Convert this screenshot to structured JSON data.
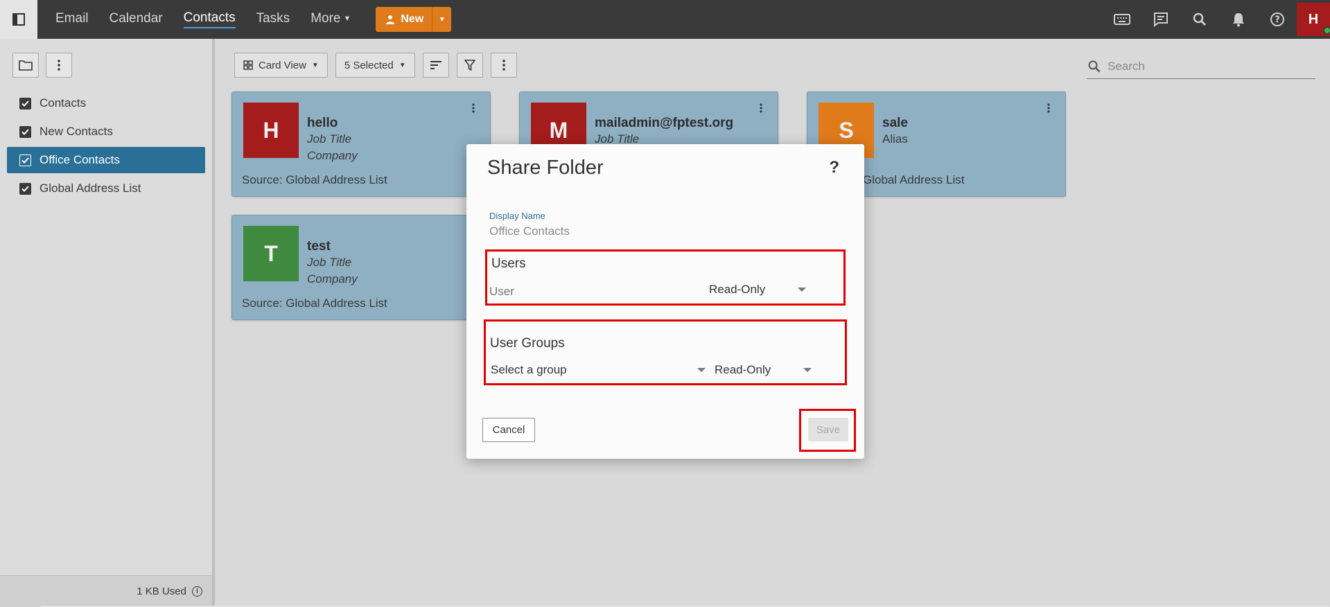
{
  "nav": {
    "links": [
      "Email",
      "Calendar",
      "Contacts",
      "Tasks",
      "More"
    ],
    "new_label": "New"
  },
  "user": {
    "initial": "H",
    "status_color": "#3cb44b",
    "avatar_color": "#a51c1c"
  },
  "sidebar": {
    "folders": [
      {
        "label": "Contacts",
        "checked": true
      },
      {
        "label": "New Contacts",
        "checked": true
      },
      {
        "label": "Office Contacts",
        "checked": true,
        "selected": true
      },
      {
        "label": "Global Address List",
        "checked": true
      }
    ],
    "quota": "1 KB Used"
  },
  "toolbar": {
    "view_label": "Card View",
    "selected_label": "5 Selected",
    "search_placeholder": "Search"
  },
  "cards": [
    {
      "initial": "H",
      "color": "#a51c1c",
      "name": "hello",
      "line1": "Job Title",
      "line2": "Company",
      "source": "Source: Global Address List"
    },
    {
      "initial": "M",
      "color": "#a51c1c",
      "name": "mailadmin@fptest.org",
      "line1": "Job Title",
      "line2": "",
      "source": ""
    },
    {
      "initial": "S",
      "color": "#e07b1c",
      "name": "sale",
      "line1": "Alias",
      "line2": "",
      "source": "Global Address List"
    },
    {
      "initial": "T",
      "color": "#3f8a3f",
      "name": "test",
      "line1": "Job Title",
      "line2": "Company",
      "source": "Source: Global Address List"
    }
  ],
  "dialog": {
    "title": "Share Folder",
    "help": "?",
    "display_name_label": "Display Name",
    "display_name_value": "Office Contacts",
    "users": {
      "title": "Users",
      "placeholder": "User",
      "permission": "Read-Only"
    },
    "groups": {
      "title": "User Groups",
      "group_select": "Select a group",
      "permission": "Read-Only"
    },
    "cancel_label": "Cancel",
    "save_label": "Save"
  },
  "icons": {
    "sidebar_toggle": "sidebar-toggle-icon",
    "keyboard": "keyboard-icon",
    "chat": "chat-icon",
    "search": "search-icon",
    "bell": "bell-icon",
    "help": "help-icon"
  }
}
